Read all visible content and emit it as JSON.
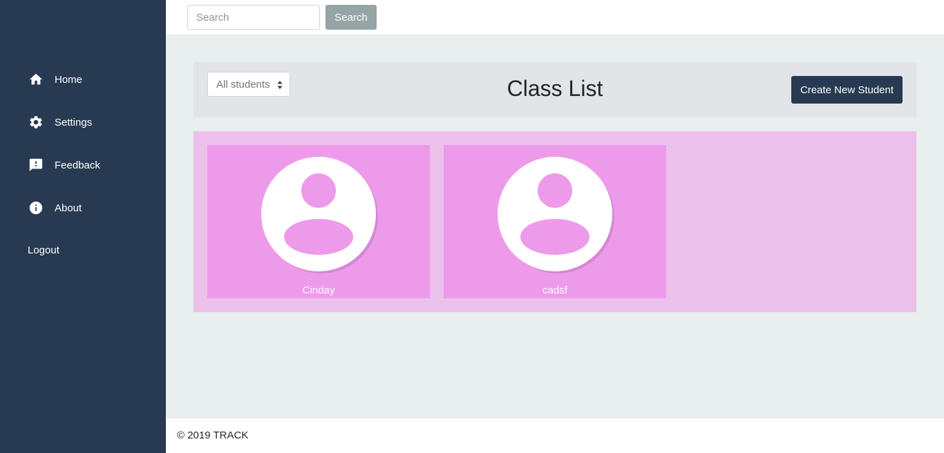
{
  "sidebar": {
    "items": [
      {
        "label": "Home",
        "icon": "home-icon"
      },
      {
        "label": "Settings",
        "icon": "gear-icon"
      },
      {
        "label": "Feedback",
        "icon": "feedback-icon"
      },
      {
        "label": "About",
        "icon": "info-icon"
      }
    ],
    "logout_label": "Logout"
  },
  "topbar": {
    "search_placeholder": "Search",
    "search_button_label": "Search"
  },
  "class_list": {
    "filter_selected": "All students",
    "title": "Class List",
    "create_button_label": "Create New Student"
  },
  "students": [
    {
      "name": "Cinday",
      "icon": "avatar-icon"
    },
    {
      "name": "cadsf",
      "icon": "avatar-icon"
    }
  ],
  "footer": {
    "copyright": "© 2019 TRACK"
  },
  "colors": {
    "sidebar": "#283a51",
    "content_bg": "#e9eeef",
    "cards_panel": "#ebc1ec",
    "student_card": "#ee9aea",
    "search_button": "#95a5a6"
  }
}
